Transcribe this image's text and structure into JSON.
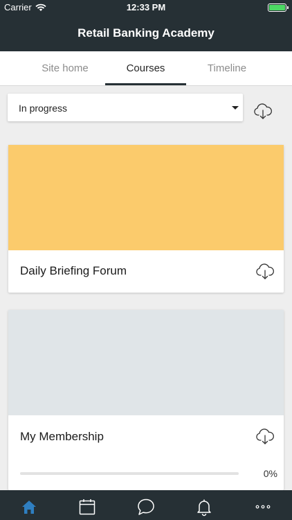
{
  "status_bar": {
    "carrier": "Carrier",
    "time": "12:33 PM",
    "battery_color": "#4cd964"
  },
  "header": {
    "title": "Retail Banking Academy",
    "background": "#263035"
  },
  "tabs": [
    {
      "label": "Site home",
      "active": false
    },
    {
      "label": "Courses",
      "active": true
    },
    {
      "label": "Timeline",
      "active": false
    }
  ],
  "filter": {
    "selected": "In progress",
    "download_icon": "cloud-download-icon"
  },
  "courses": [
    {
      "title": "Daily Briefing Forum",
      "image_color": "#fbcb6c",
      "download_icon": "cloud-download-icon"
    },
    {
      "title": "My Membership",
      "image_color": "#e0e5e8",
      "download_icon": "cloud-download-icon",
      "progress": 0,
      "progress_text": "0%"
    }
  ],
  "bottom_nav": [
    {
      "name": "home-icon",
      "active": true
    },
    {
      "name": "calendar-icon",
      "active": false
    },
    {
      "name": "messages-icon",
      "active": false
    },
    {
      "name": "bell-icon",
      "active": false
    },
    {
      "name": "more-icon",
      "active": false
    }
  ],
  "colors": {
    "nav_active": "#2f7fc1",
    "nav_inactive": "#ffffff"
  }
}
